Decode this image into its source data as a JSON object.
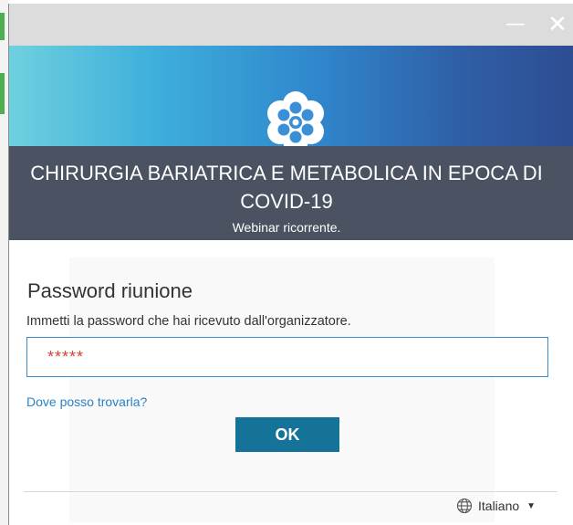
{
  "window": {
    "minimize_icon": "minimize-icon",
    "close_icon": "close-icon",
    "minimize_symbol": "—",
    "close_symbol": "✕"
  },
  "banner": {
    "logo_icon": "webex-logo-icon",
    "meeting_title": "CHIRURGIA BARIATRICA E METABOLICA IN EPOCA DI COVID-19",
    "meeting_subtitle": "Webinar ricorrente.",
    "gradient_start": "#6fd0de",
    "gradient_end": "#2d4d92",
    "dark_band": "#4b5262"
  },
  "password_form": {
    "title": "Password riunione",
    "description": "Immetti la password che hai ricevuto dall'organizzatore.",
    "password_masked": "*****",
    "help_link": "Dove posso trovarla?",
    "ok_label": "OK",
    "button_color": "#157399",
    "link_color": "#2a83c6"
  },
  "footer": {
    "language_icon": "globe-icon",
    "language": "Italiano",
    "dropdown_icon": "caret-down-icon"
  }
}
